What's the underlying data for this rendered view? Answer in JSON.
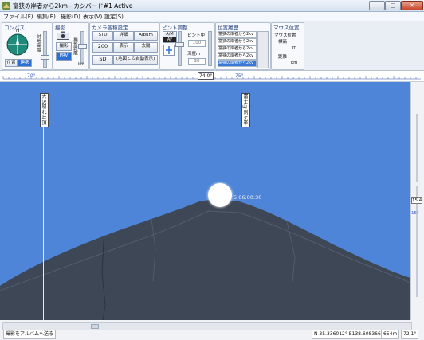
{
  "window": {
    "title": "富狭の岸者から2km - カシバード#1 Active",
    "controls": {
      "minimize": "–",
      "maximize": "□",
      "close": "✕"
    }
  },
  "menu": [
    "ファイル(F)",
    "編集(E)",
    "撮影(D)",
    "表示(V)",
    "設定(S)"
  ],
  "toolbar": {
    "compass": {
      "title": "コンパス",
      "north": "N",
      "btn_position": "位置",
      "btn_link": "連携",
      "vertical_label": "対地高度"
    },
    "shoot": {
      "title": "撮影",
      "btn_shoot": "撮影",
      "btn_prv": "PRV",
      "vertical_label": "撮影距離",
      "unit": "km"
    },
    "camera": {
      "title": "カメラ各種設定",
      "btn_std": "STD",
      "btn_zoom": "詳細",
      "btn_album": "Album",
      "btn_200": "200",
      "btn_display": "表示",
      "btn_sun": "太陽",
      "btn_sd": "SD",
      "btn_map": "(地図との自動表示)"
    },
    "focus": {
      "title": "ピント調整",
      "btn_am": "A/M",
      "btn_af": "AF",
      "label_focus": "ピント中",
      "val_focus": "100",
      "label_depth": "深度m",
      "val_depth": "30"
    },
    "layers": {
      "title": "位置履歴",
      "items": [
        "富狭の岸者から2kv",
        "富狭の岸者から2kv",
        "富狭の岸者から2kv",
        "富狭の岸者から2kv",
        "富狭の岸者から2kv"
      ],
      "selected_index": 4
    },
    "mouse": {
      "title": "マウス位置",
      "lbl_pos": "マウス位置",
      "lbl_alt": "標高",
      "val_alt": "m",
      "lbl_dist": "距離",
      "val_dist": "km"
    }
  },
  "ruler": {
    "left_label": "70°",
    "center_label": "74.0°",
    "right_label": "75°"
  },
  "scene": {
    "label_left": "大沢崩れ丘頂",
    "label_right": "富士山・剣ヶ峯",
    "sun_time": "5 06:00:30",
    "right_edge_top": "15.4",
    "right_edge_bottom": "15°",
    "colors": {
      "sky": "#4f85d8",
      "mountain": "#3e4756",
      "sun": "#ffffff"
    }
  },
  "status": {
    "album_button": "撮影をアルバムへ送る",
    "coords": "N 35.336012°  E138.608366°",
    "altitude": "654m",
    "angle": "72.1°"
  }
}
